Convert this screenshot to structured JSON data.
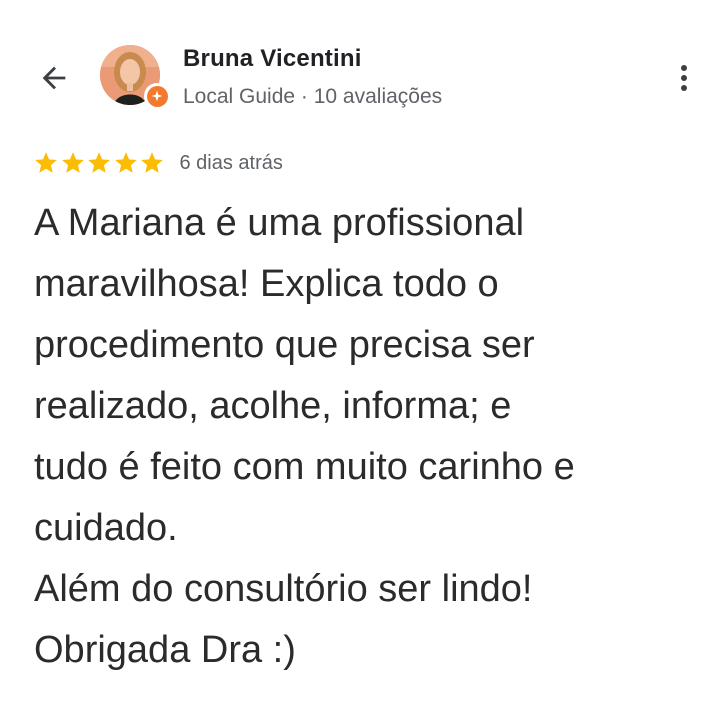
{
  "header": {
    "back_icon": "arrow-back-icon",
    "more_icon": "more-vert-icon"
  },
  "reviewer": {
    "name": "Bruna Vicentini",
    "meta": "Local Guide · 10 avaliações",
    "avatar_icon": "profile-photo",
    "badge_icon": "local-guide-badge-icon",
    "badge_color": "#f2792e"
  },
  "review": {
    "rating": 5,
    "max_rating": 5,
    "star_color": "#fbbc04",
    "date": "6 dias atrás",
    "text": "A Mariana é uma profissional\nmaravilhosa! Explica todo o\nprocedimento que precisa ser\nrealizado, acolhe, informa; e\ntudo é feito com muito carinho e\ncuidado.\nAlém do consultório ser lindo!\nObrigada Dra :)"
  }
}
